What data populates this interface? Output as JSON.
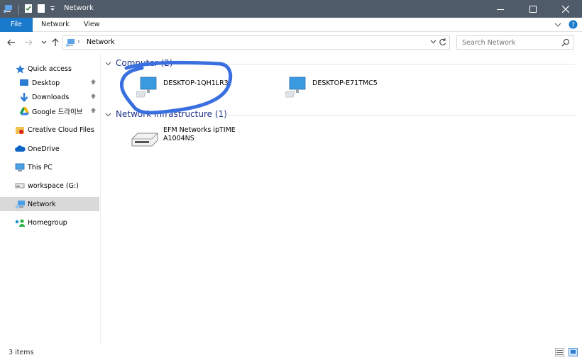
{
  "window": {
    "title": "Network"
  },
  "ribbon": {
    "tabs": [
      "File",
      "Network",
      "View"
    ]
  },
  "address": {
    "crumb": "Network"
  },
  "search": {
    "placeholder": "Search Network"
  },
  "nav": {
    "items": [
      {
        "label": "Quick access",
        "icon": "star-icon"
      },
      {
        "label": "Desktop",
        "icon": "desktop-icon",
        "pinned": true
      },
      {
        "label": "Downloads",
        "icon": "download-icon",
        "pinned": true
      },
      {
        "label": "Google 드라이브",
        "icon": "google-drive-icon",
        "pinned": true
      },
      {
        "label": "Creative Cloud Files",
        "icon": "creative-cloud-icon"
      },
      {
        "label": "OneDrive",
        "icon": "cloud-icon"
      },
      {
        "label": "This PC",
        "icon": "computer-icon"
      },
      {
        "label": "workspace (G:)",
        "icon": "drive-icon"
      },
      {
        "label": "Network",
        "icon": "network-icon",
        "selected": true
      },
      {
        "label": "Homegroup",
        "icon": "homegroup-icon"
      }
    ]
  },
  "groups": [
    {
      "header": "Computer (2)",
      "items": [
        {
          "name": "DESKTOP-1QH1LR3",
          "icon": "computer-icon"
        },
        {
          "name": "DESKTOP-E71TMC5",
          "icon": "computer-icon"
        }
      ]
    },
    {
      "header": "Network Infrastructure (1)",
      "items": [
        {
          "name_line1": "EFM Networks ipTIME",
          "name_line2": "A1004NS",
          "icon": "router-icon"
        }
      ]
    }
  ],
  "status": {
    "count": "3 items"
  },
  "colors": {
    "accent": "#1979ca",
    "titlebar": "#4f5b69",
    "group_header": "#1e3287",
    "annotation": "#3a6fe0"
  }
}
